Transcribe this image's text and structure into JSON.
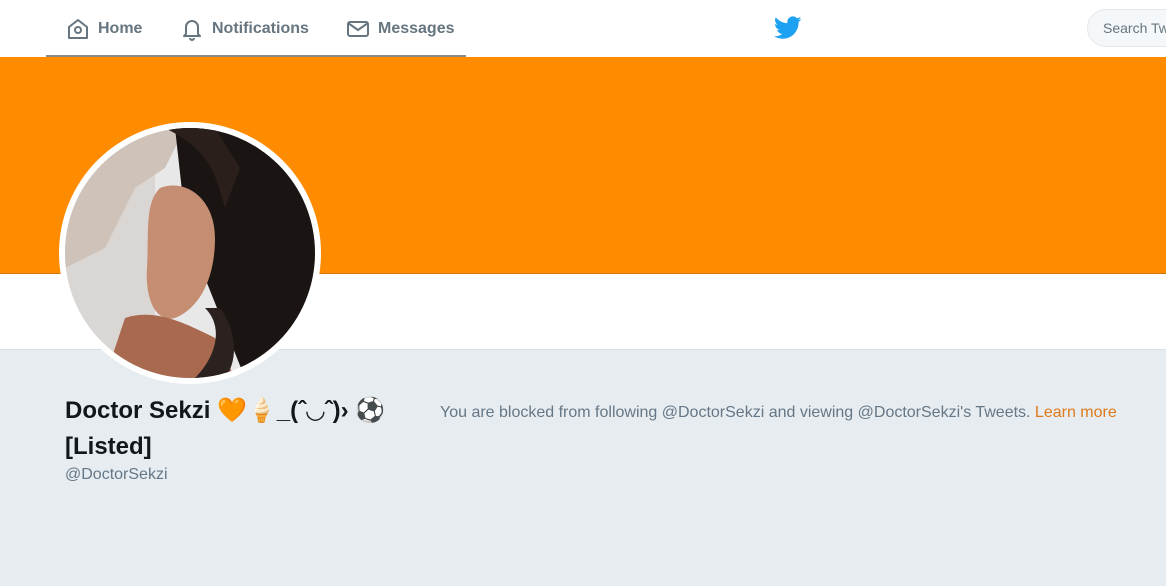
{
  "nav": {
    "home_label": "Home",
    "notifications_label": "Notifications",
    "messages_label": "Messages"
  },
  "search": {
    "placeholder": "Search Twitter"
  },
  "colors": {
    "banner": "#ff8c00",
    "link": "#e0791a",
    "twitter_blue": "#1da1f2",
    "page_bg": "#e6ecf0"
  },
  "profile": {
    "display_name": "Doctor Sekzi 🧡🍦_(ˆ◡ˆ)› ⚽ [Listed]",
    "handle": "@DoctorSekzi"
  },
  "blocked": {
    "message": "You are blocked from following @DoctorSekzi and viewing @DoctorSekzi's Tweets. ",
    "learn_more": "Learn more"
  }
}
